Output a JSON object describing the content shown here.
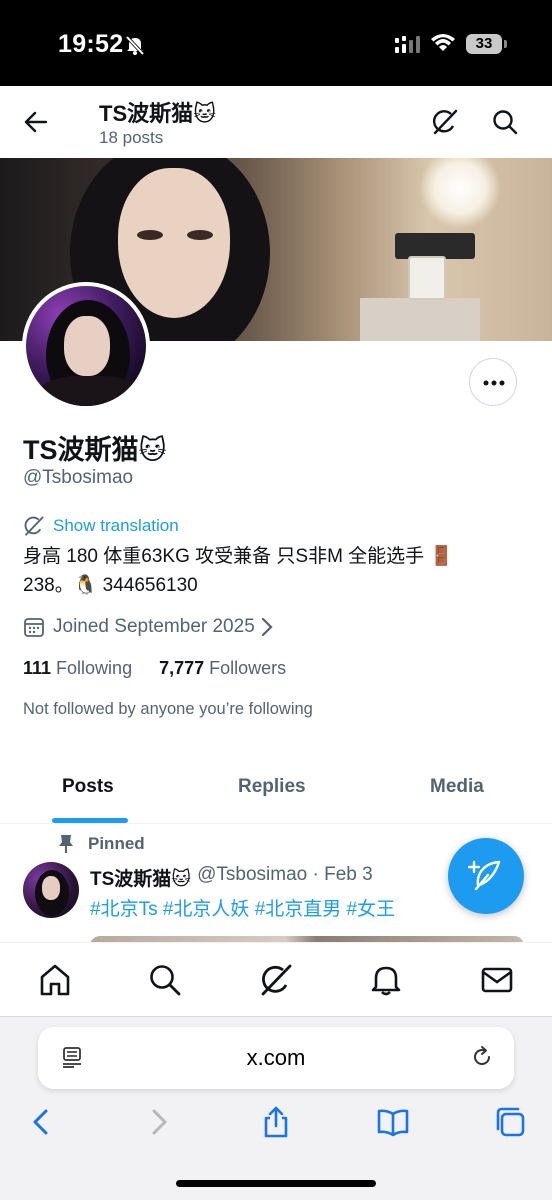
{
  "status_bar": {
    "time": "19:52",
    "battery": "33"
  },
  "header": {
    "name": "TS波斯猫🐱",
    "posts": "18 posts"
  },
  "profile": {
    "name": "TS波斯猫🐱",
    "handle": "@Tsbosimao",
    "translate_label": "Show translation",
    "bio_line1": "身高 180 体重63KG 攻受兼备 只S非M 全能选手 🚪",
    "bio_line2": "238。🐧 344656130",
    "joined": "Joined September 2025",
    "following_count": "111",
    "following_label": "Following",
    "followers_count": "7,777",
    "followers_label": "Followers",
    "not_followed": "Not followed by anyone you’re following"
  },
  "tabs": [
    {
      "label": "Posts",
      "active": true
    },
    {
      "label": "Replies",
      "active": false
    },
    {
      "label": "Media",
      "active": false
    }
  ],
  "pinned_post": {
    "pinned_label": "Pinned",
    "author": "TS波斯猫🐱",
    "meta": "@Tsbosimao · Feb 3",
    "text": "#北京Ts #北京人妖 #北京直男 #女王"
  },
  "bottom_nav": [
    "home-icon",
    "search-icon",
    "grok-icon",
    "notifications-icon",
    "messages-icon"
  ],
  "browser": {
    "url": "x.com"
  },
  "colors": {
    "accent": "#1d9bf0",
    "text": "#0f1419",
    "secondary": "#536471"
  }
}
